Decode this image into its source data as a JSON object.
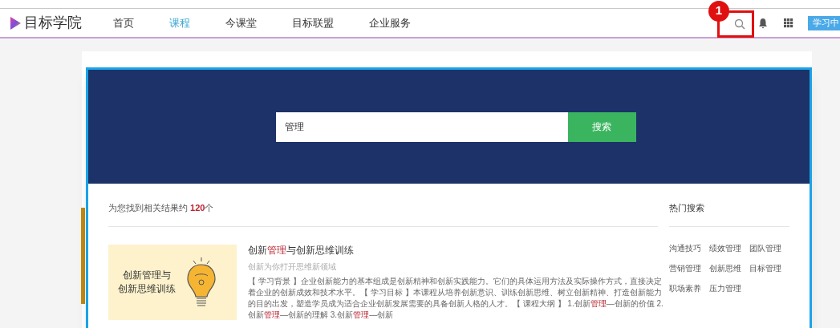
{
  "header": {
    "logo": "目标学院",
    "nav": [
      {
        "label": "首页",
        "selected": false
      },
      {
        "label": "课程",
        "selected": true
      },
      {
        "label": "今课堂",
        "selected": false
      },
      {
        "label": "目标联盟",
        "selected": false
      },
      {
        "label": "企业服务",
        "selected": false
      }
    ],
    "annotation": {
      "label": "1"
    },
    "learning_center": "学习中"
  },
  "search": {
    "value": "管理",
    "button": "搜索"
  },
  "results": {
    "summary": [
      {
        "text": "为您找到相关结果约 ",
        "highlight": false
      },
      {
        "text": "120",
        "highlight": true
      },
      {
        "text": "个",
        "highlight": false
      }
    ],
    "items": [
      {
        "thumbnail": {
          "lines": [
            "创新管理与",
            "创新思维训练"
          ]
        },
        "title": [
          {
            "text": "创新",
            "highlight": false
          },
          {
            "text": "管理",
            "highlight": true
          },
          {
            "text": "与创新思维训练",
            "highlight": false
          }
        ],
        "subtitle": "创新为你打开思维新领域",
        "description": [
          {
            "text": "【 学习背景 】企业创新能力的基本组成是创新精神和创新实践能力。它们的具体运用方法及实际操作方式，直接决定着企业的创新成效和技术水平。【 学习目标 】本课程从培养创新意识、训练创新思维、树立创新精神、打造创新能力的目的出发，塑造学员成为适合企业创新发展需要的具备创新人格的人才。【 课程大纲 】 1.创新",
            "highlight": false
          },
          {
            "text": "管理",
            "highlight": true
          },
          {
            "text": "—创新的价值 2.创新",
            "highlight": false
          },
          {
            "text": "管理",
            "highlight": true
          },
          {
            "text": "—创新的理解 3.创新",
            "highlight": false
          },
          {
            "text": "管理",
            "highlight": true
          },
          {
            "text": "—创新",
            "highlight": false
          }
        ]
      }
    ]
  },
  "hot_search": {
    "title": "热门搜索",
    "tags": [
      "沟通技巧",
      "绩效管理",
      "团队管理",
      "营销管理",
      "创新思维",
      "目标管理",
      "职场素养",
      "压力管理"
    ]
  }
}
